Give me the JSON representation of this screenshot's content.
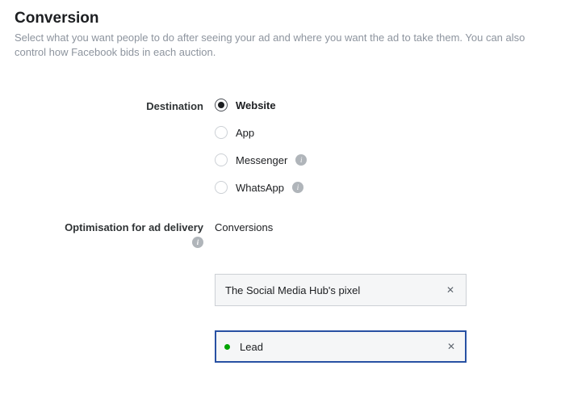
{
  "section": {
    "title": "Conversion",
    "description": "Select what you want people to do after seeing your ad and where you want the ad to take them. You can also control how Facebook bids in each auction."
  },
  "destination": {
    "label": "Destination",
    "options": [
      {
        "label": "Website",
        "selected": true,
        "info": false
      },
      {
        "label": "App",
        "selected": false,
        "info": false
      },
      {
        "label": "Messenger",
        "selected": false,
        "info": true
      },
      {
        "label": "WhatsApp",
        "selected": false,
        "info": true
      }
    ]
  },
  "optimisation": {
    "label": "Optimisation for ad delivery",
    "value": "Conversions"
  },
  "pixel": {
    "selected": "The Social Media Hub's pixel"
  },
  "event": {
    "value": "Lead",
    "status": "active"
  }
}
